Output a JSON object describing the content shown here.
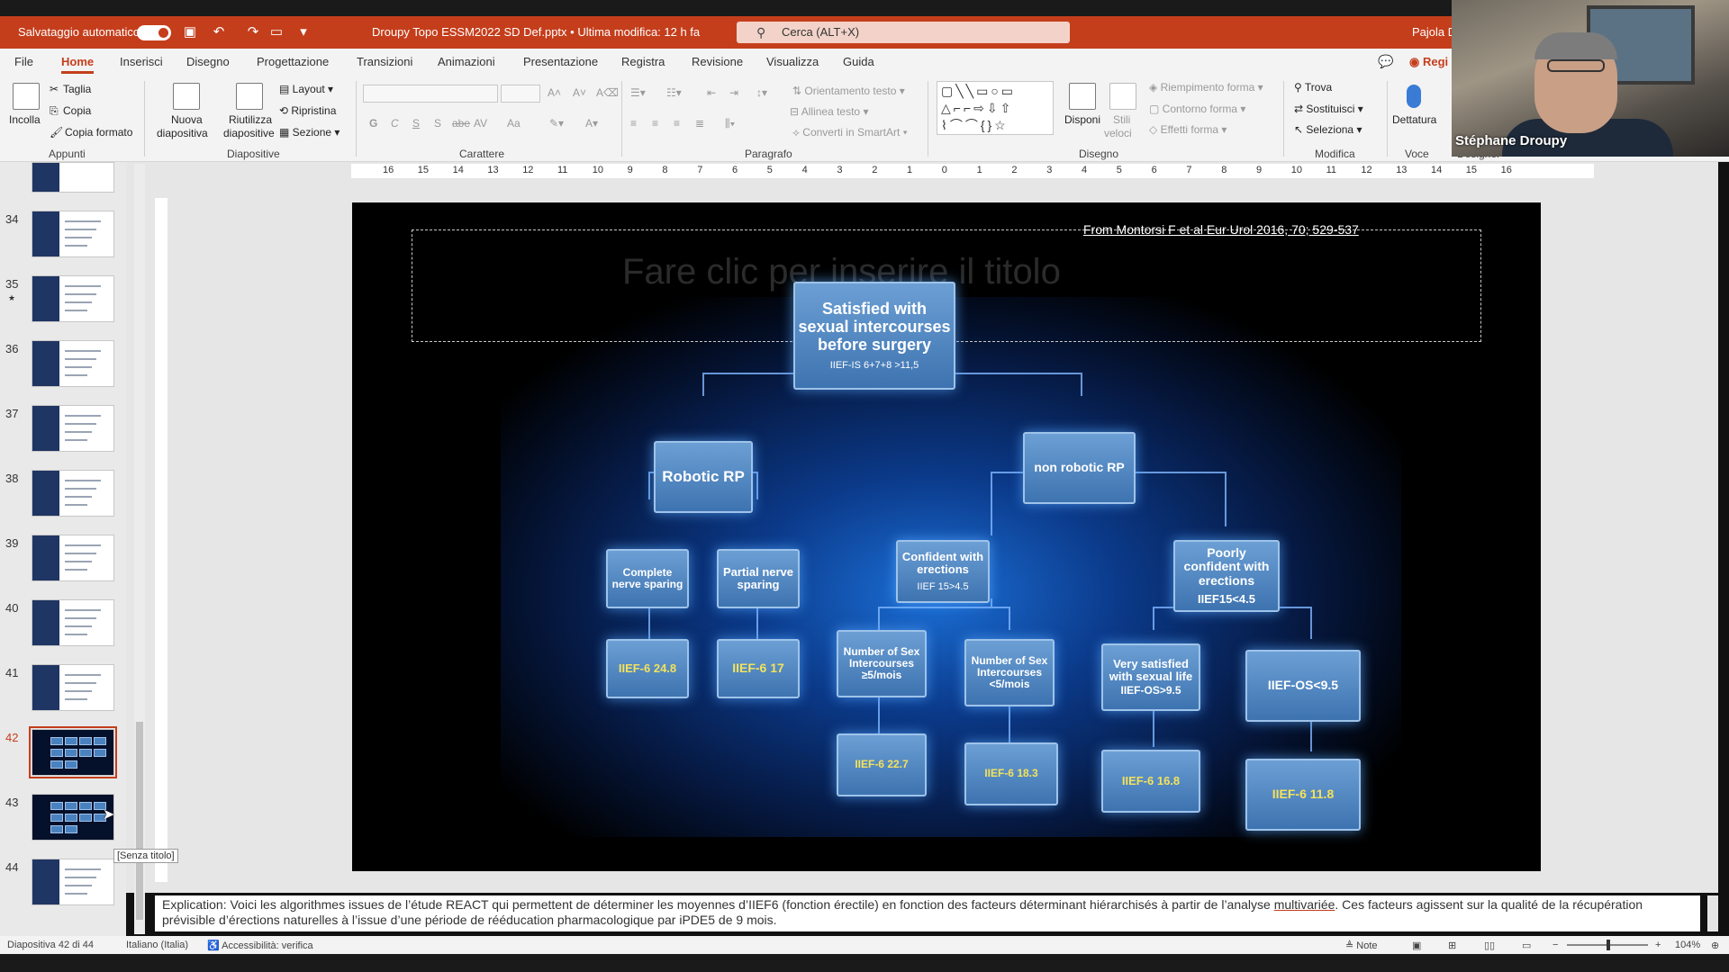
{
  "titlebar": {
    "autosave_label": "Salvataggio automatico",
    "file_title": "Droupy Topo ESSM2022 SD Def.pptx • Ultima modifica: 12 h fa",
    "search_placeholder": "Cerca (ALT+X)",
    "user": "Pajola D"
  },
  "tabs": [
    "File",
    "Home",
    "Inserisci",
    "Disegno",
    "Progettazione",
    "Transizioni",
    "Animazioni",
    "Presentazione",
    "Registra",
    "Revisione",
    "Visualizza",
    "Guida"
  ],
  "active_tab": "Home",
  "record_label": "Regi",
  "ribbon": {
    "appunti": {
      "incolla": "Incolla",
      "taglia": "Taglia",
      "copia": "Copia",
      "copia_formato": "Copia formato",
      "label": "Appunti"
    },
    "diapositive": {
      "nuova": "Nuova",
      "nuova2": "diapositiva",
      "riutilizza": "Riutilizza",
      "riutilizza2": "diapositive",
      "layout": "Layout",
      "ripristina": "Ripristina",
      "sezione": "Sezione",
      "label": "Diapositive"
    },
    "carattere": {
      "bold": "G",
      "italic": "C",
      "underline": "S",
      "shadow": "S",
      "strike": "abe",
      "spacing": "AV",
      "case": "Aa",
      "label": "Carattere"
    },
    "paragrafo": {
      "orientamento": "Orientamento testo",
      "allinea": "Allinea testo",
      "converti": "Converti in SmartArt",
      "label": "Paragrafo"
    },
    "disegno": {
      "disponi": "Disponi",
      "stili": "Stili",
      "stili2": "veloci",
      "riempimento": "Riempimento forma",
      "contorno": "Contorno forma",
      "effetti": "Effetti forma",
      "label": "Disegno"
    },
    "modifica": {
      "trova": "Trova",
      "sostituisci": "Sostituisci",
      "seleziona": "Seleziona",
      "label": "Modifica"
    },
    "voce": {
      "dettatura": "Dettatura",
      "label": "Voce"
    },
    "designer": "Designer"
  },
  "ruler_numbers": [
    "16",
    "15",
    "14",
    "13",
    "12",
    "11",
    "10",
    "9",
    "8",
    "7",
    "6",
    "5",
    "4",
    "3",
    "2",
    "1",
    "0",
    "1",
    "2",
    "3",
    "4",
    "5",
    "6",
    "7",
    "8",
    "9",
    "10",
    "11",
    "12",
    "13",
    "14",
    "15",
    "16"
  ],
  "slides_panel": {
    "items": [
      {
        "num": "34",
        "star": false,
        "dark": false
      },
      {
        "num": "35",
        "star": true,
        "dark": false
      },
      {
        "num": "36",
        "star": false,
        "dark": false
      },
      {
        "num": "37",
        "star": false,
        "dark": false
      },
      {
        "num": "38",
        "star": false,
        "dark": false
      },
      {
        "num": "39",
        "star": false,
        "dark": false
      },
      {
        "num": "40",
        "star": false,
        "dark": false
      },
      {
        "num": "41",
        "star": false,
        "dark": false
      },
      {
        "num": "42",
        "star": false,
        "dark": true,
        "selected": true
      },
      {
        "num": "43",
        "star": false,
        "dark": true
      },
      {
        "num": "44",
        "star": false,
        "dark": false
      }
    ],
    "tooltip": "[Senza titolo]"
  },
  "slide": {
    "citation": "From Montorsi F et al Eur Urol 2016, 70; 529-537",
    "ghost_title": "Fare clic per inserire il titolo",
    "boxes": {
      "root": {
        "title": "Satisfied with sexual intercourses before surgery",
        "sub": "IIEF-IS 6+7+8 >11,5"
      },
      "robotic": "Robotic RP",
      "nonrobotic": "non robotic RP",
      "complete": "Complete nerve sparing",
      "partial": "Partial nerve sparing",
      "confident": {
        "title": "Confident with erections",
        "sub": "IIEF 15>4.5"
      },
      "poorly": {
        "title": "Poorly confident with erections",
        "sub": "IIEF15<4.5"
      },
      "iief248": "IIEF-6  24.8",
      "iief17": "IIEF-6  17",
      "sexge5": "Number of Sex Intercourses ≥5/mois",
      "sexlt5": "Number of Sex Intercourses <5/mois",
      "verysat": {
        "title": "Very satisfied with sexual life",
        "sub": "IIEF-OS>9.5"
      },
      "iiefos": "IIEF-OS<9.5",
      "iief227": "IIEF-6 22.7",
      "iief183": "IIEF-6  18.3",
      "iief168": "IIEF-6  16.8",
      "iief118": "IIEF-6  11.8"
    }
  },
  "notes": {
    "line1_a": "Explication: Voici les algorithmes issues de l’étude REACT qui permettent de déterminer les moyennes d’IIEF6 (fonction érectile) en fonction des facteurs déterminant hiérarchisés à partir de l’analyse ",
    "line1_ul": "multivariée",
    "line1_b": ". Ces facteurs agissent sur la qualité de la récupération",
    "line2": "prévisible d’érections naturelles à l’issue d’une période de rééducation pharmacologique par iPDE5 de 9 mois."
  },
  "statusbar": {
    "slide_count": "Diapositiva 42 di 44",
    "language": "Italiano (Italia)",
    "accessibility": "Accessibilità: verifica",
    "notes_btn": "Note",
    "zoom": "104%"
  },
  "webcam": {
    "name": "Stéphane Droupy"
  },
  "colors": {
    "accent": "#c43e1c",
    "slide_box": "#4a82c0"
  }
}
